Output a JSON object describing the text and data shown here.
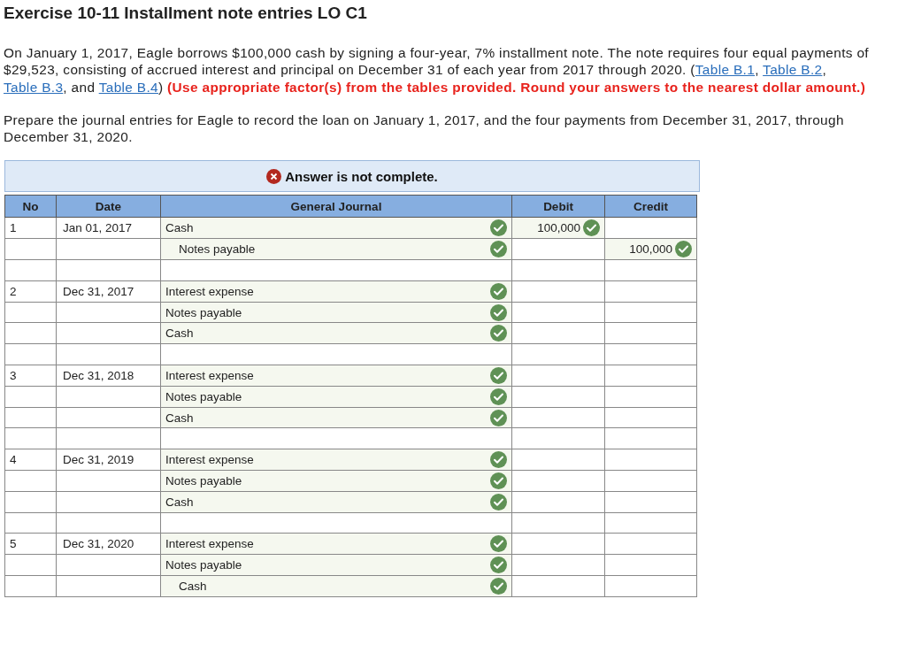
{
  "title": "Exercise 10-11 Installment note entries LO C1",
  "problem": [
    {
      "kind": "text",
      "text": "On January 1, 2017, Eagle borrows $100,000 cash by signing a four-year, 7% installment note. The note requires four equal payments of $29,523, consisting of accrued interest and principal on December 31 of each year from 2017 through 2020. ("
    },
    {
      "kind": "link",
      "text": "Table B.1"
    },
    {
      "kind": "text",
      "text": ", "
    },
    {
      "kind": "link",
      "text": "Table B.2"
    },
    {
      "kind": "text",
      "text": ", "
    },
    {
      "kind": "link",
      "text": "Table B.3"
    },
    {
      "kind": "text",
      "text": ", and "
    },
    {
      "kind": "link",
      "text": "Table B.4"
    },
    {
      "kind": "text",
      "text": ") "
    },
    {
      "kind": "note",
      "text": "(Use appropriate factor(s) from the tables provided. Round your answers to the nearest dollar amount.)"
    }
  ],
  "instruction": "Prepare the journal entries for Eagle to record the loan on January 1, 2017, and the four payments from December 31, 2017, through December 31, 2020.",
  "banner": {
    "complete": false,
    "text": "Answer is not complete."
  },
  "table": {
    "columns": [
      "No",
      "Date",
      "General Journal",
      "Debit",
      "Credit"
    ],
    "rows": [
      {
        "kind": "entry",
        "no": "1",
        "date": "Jan 01, 2017",
        "account": "Cash",
        "indented": false,
        "account_correct": true,
        "debit": "100,000",
        "debit_correct": true
      },
      {
        "kind": "entry",
        "account": "Notes payable",
        "indented": true,
        "account_correct": true,
        "credit": "100,000",
        "credit_correct": true
      },
      {
        "kind": "blank"
      },
      {
        "kind": "entry",
        "no": "2",
        "date": "Dec 31, 2017",
        "account": "Interest expense",
        "indented": false,
        "account_correct": true
      },
      {
        "kind": "entry",
        "account": "Notes payable",
        "indented": false,
        "account_correct": true
      },
      {
        "kind": "entry",
        "account": "Cash",
        "indented": false,
        "account_correct": true
      },
      {
        "kind": "blank"
      },
      {
        "kind": "entry",
        "no": "3",
        "date": "Dec 31, 2018",
        "account": "Interest expense",
        "indented": false,
        "account_correct": true
      },
      {
        "kind": "entry",
        "account": "Notes payable",
        "indented": false,
        "account_correct": true
      },
      {
        "kind": "entry",
        "account": "Cash",
        "indented": false,
        "account_correct": true
      },
      {
        "kind": "blank"
      },
      {
        "kind": "entry",
        "no": "4",
        "date": "Dec 31, 2019",
        "account": "Interest expense",
        "indented": false,
        "account_correct": true
      },
      {
        "kind": "entry",
        "account": "Notes payable",
        "indented": false,
        "account_correct": true
      },
      {
        "kind": "entry",
        "account": "Cash",
        "indented": false,
        "account_correct": true
      },
      {
        "kind": "blank"
      },
      {
        "kind": "entry",
        "no": "5",
        "date": "Dec 31, 2020",
        "account": "Interest expense",
        "indented": false,
        "account_correct": true
      },
      {
        "kind": "entry",
        "account": "Notes payable",
        "indented": false,
        "account_correct": true
      },
      {
        "kind": "entry",
        "account": "Cash",
        "indented": true,
        "account_correct": true
      }
    ]
  }
}
